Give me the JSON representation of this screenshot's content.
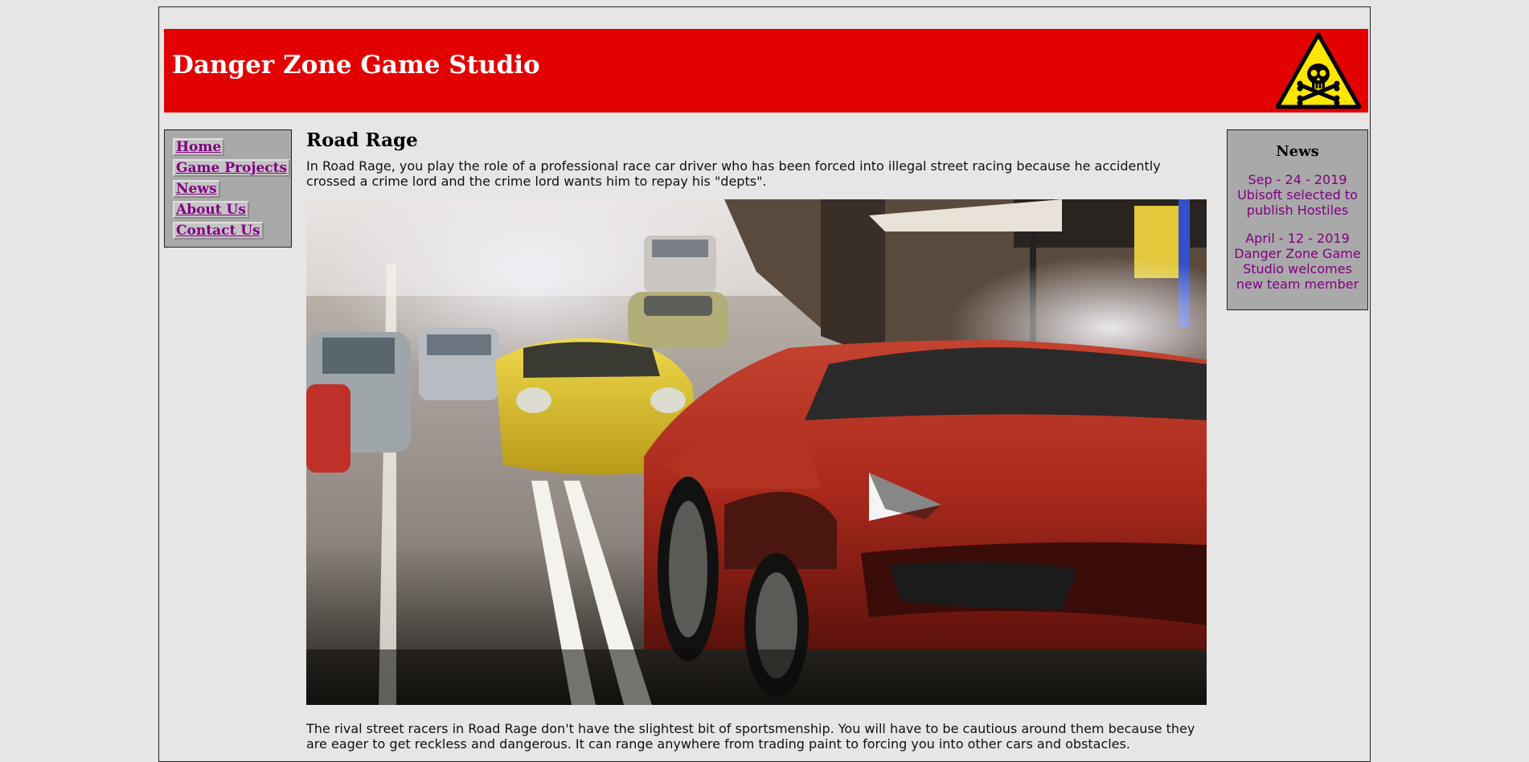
{
  "header": {
    "site_title": "Danger Zone Game Studio",
    "logo_icon": "skull-crossbones-warning-icon",
    "banner_color": "#e30000"
  },
  "nav": {
    "items": [
      {
        "label": "Home"
      },
      {
        "label": "Game Projects"
      },
      {
        "label": "News"
      },
      {
        "label": "About Us"
      },
      {
        "label": "Contact Us"
      }
    ],
    "link_color": "#800080"
  },
  "main": {
    "title": "Road Rage",
    "intro": "In Road Rage, you play the role of a professional race car driver who has been forced into illegal street racing because he accidently crossed a crime lord and the crime lord wants him to repay his \"depts\".",
    "image_subject": "street-racing-cars-photo",
    "after_text": "The rival street racers in Road Rage don't have the slightest bit of sportsmenship. You will have to be cautious around them because they are eager to get reckless and dangerous. It can range anywhere from trading paint to forcing you into other cars and obstacles."
  },
  "news": {
    "title": "News",
    "items": [
      {
        "text": "Sep - 24 - 2019 Ubisoft selected to publish Hostiles"
      },
      {
        "text": "April - 12 - 2019 Danger Zone Game Studio welcomes new team member"
      }
    ]
  }
}
